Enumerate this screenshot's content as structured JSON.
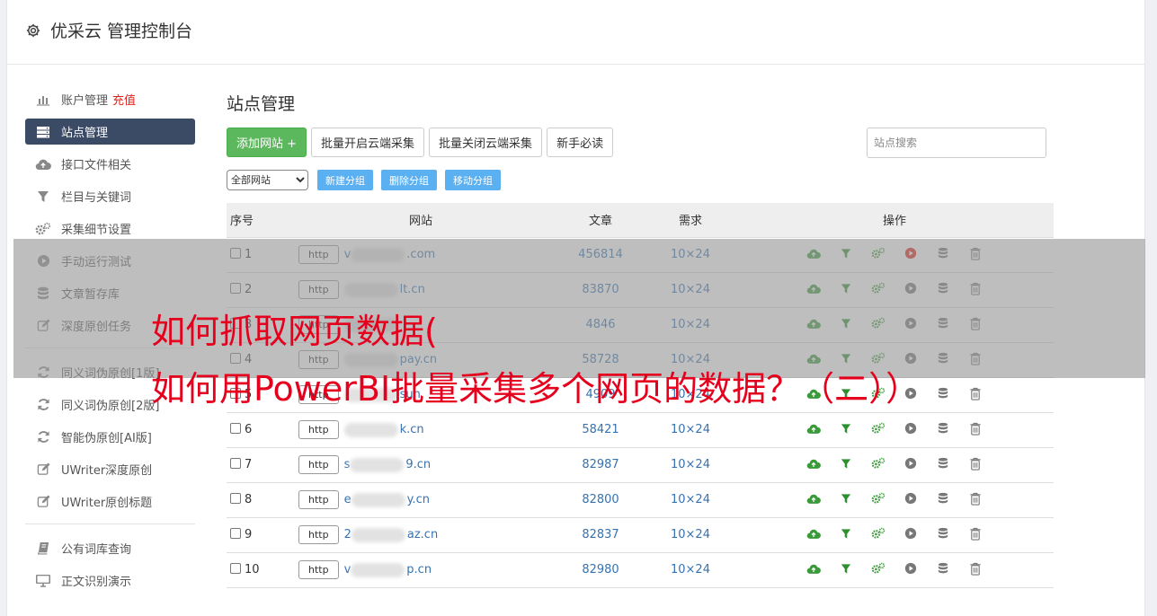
{
  "app": {
    "title": "优采云 管理控制台"
  },
  "sidebar": {
    "items": [
      {
        "label": "账户管理",
        "extra": "充值",
        "icon": "bar-chart-icon"
      },
      {
        "label": "站点管理",
        "icon": "server-icon",
        "active": true
      },
      {
        "label": "接口文件相关",
        "icon": "cloud-upload-icon"
      },
      {
        "label": "栏目与关键词",
        "icon": "filter-icon"
      },
      {
        "label": "采集细节设置",
        "icon": "gears-icon"
      },
      {
        "label": "手动运行测试",
        "icon": "play-circle-icon"
      },
      {
        "label": "文章暂存库",
        "icon": "database-icon"
      },
      {
        "label": "深度原创任务",
        "icon": "edit-icon"
      }
    ],
    "items2": [
      {
        "label": "同义词伪原创[1版]",
        "icon": "refresh-icon"
      },
      {
        "label": "同义词伪原创[2版]",
        "icon": "refresh-icon"
      },
      {
        "label": "智能伪原创[AI版]",
        "icon": "refresh-icon"
      },
      {
        "label": "UWriter深度原创",
        "icon": "edit-icon"
      },
      {
        "label": "UWriter原创标题",
        "icon": "edit-icon"
      }
    ],
    "items3": [
      {
        "label": "公有词库查询",
        "icon": "book-icon"
      },
      {
        "label": "正文识别演示",
        "icon": "monitor-icon"
      }
    ]
  },
  "main": {
    "title": "站点管理",
    "buttons": {
      "add": "添加网站 +",
      "batch_on": "批量开启云端采集",
      "batch_off": "批量关闭云端采集",
      "guide": "新手必读"
    },
    "search_placeholder": "站点搜索",
    "group_select": "全部网站",
    "group_buttons": {
      "new": "新建分组",
      "delete": "删除分组",
      "move": "移动分组"
    },
    "table": {
      "headers": {
        "idx": "序号",
        "site": "网站",
        "articles": "文章",
        "demand": "需求",
        "ops": "操作"
      },
      "protocol": "http",
      "rows": [
        {
          "idx": "1",
          "domain": "v",
          "domain_tail": ".com",
          "articles": "456814",
          "demand": "10×24",
          "run_active": true
        },
        {
          "idx": "2",
          "domain": "",
          "domain_tail": "lt.cn",
          "articles": "83870",
          "demand": "10×24"
        },
        {
          "idx": "3",
          "domain": "",
          "domain_tail": "",
          "articles": "4846",
          "demand": "10×24"
        },
        {
          "idx": "4",
          "domain": "",
          "domain_tail": "pay.cn",
          "articles": "58728",
          "demand": "10×24"
        },
        {
          "idx": "5",
          "domain": "",
          "domain_tail": "sun",
          "articles": "4909",
          "demand": "10×24"
        },
        {
          "idx": "6",
          "domain": "",
          "domain_tail": "k.cn",
          "articles": "58421",
          "demand": "10×24"
        },
        {
          "idx": "7",
          "domain": "s",
          "domain_tail": "9.cn",
          "articles": "82987",
          "demand": "10×24"
        },
        {
          "idx": "8",
          "domain": "e",
          "domain_tail": "y.cn",
          "articles": "82800",
          "demand": "10×24"
        },
        {
          "idx": "9",
          "domain": "2",
          "domain_tail": "az.cn",
          "articles": "82837",
          "demand": "10×24"
        },
        {
          "idx": "10",
          "domain": "v",
          "domain_tail": "p.cn",
          "articles": "82980",
          "demand": "10×24"
        }
      ]
    }
  },
  "overlay": {
    "line1": "如何抓取网页数据(",
    "line2": "如何用PowerBI批量采集多个网页的数据？（二））"
  },
  "colors": {
    "accent_green": "#5cb85c",
    "active_nav": "#3b4a65",
    "link_blue": "#3672b0",
    "overlay_red": "#e5001d",
    "group_blue": "#5bb0f2"
  }
}
